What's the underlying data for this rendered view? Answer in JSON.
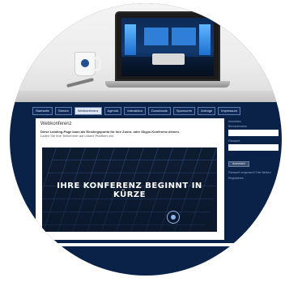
{
  "hero": {
    "alt": "Laptop mit virtuellem Studio auf einem Schreibtisch"
  },
  "nav": {
    "items": [
      {
        "label": "Startseite"
      },
      {
        "label": "Stream"
      },
      {
        "label": "Webkonferenz"
      },
      {
        "label": "Agenda"
      },
      {
        "label": "Interaktion"
      },
      {
        "label": "Downloads"
      },
      {
        "label": "Sponsoren"
      },
      {
        "label": "Anfrage"
      },
      {
        "label": "Impressum"
      }
    ],
    "active_index": 2
  },
  "content": {
    "title": "Webkonferenz",
    "intro_bold": "Diese Landing-Page kann als Einstiegspunkt für Ihre Zoom- oder Skype-Konferenz dienen.",
    "intro_text": "Laden Sie Ihre Teilnehmer auf unsere Plattform ein.",
    "banner_text": "IHRE KONFERENZ BEGINNT IN KÜRZE"
  },
  "sidebar": {
    "login_label": "Anmelden",
    "user_label": "Benutzername",
    "password_label": "Passwort",
    "button_label": "Anmelden",
    "link1": "Passwort vergessen? Hier klicken",
    "link2": "Registrieren"
  },
  "colors": {
    "navy": "#0b2248",
    "nav_active_bg": "#dfe7f4",
    "content_bg": "#ffffff"
  }
}
